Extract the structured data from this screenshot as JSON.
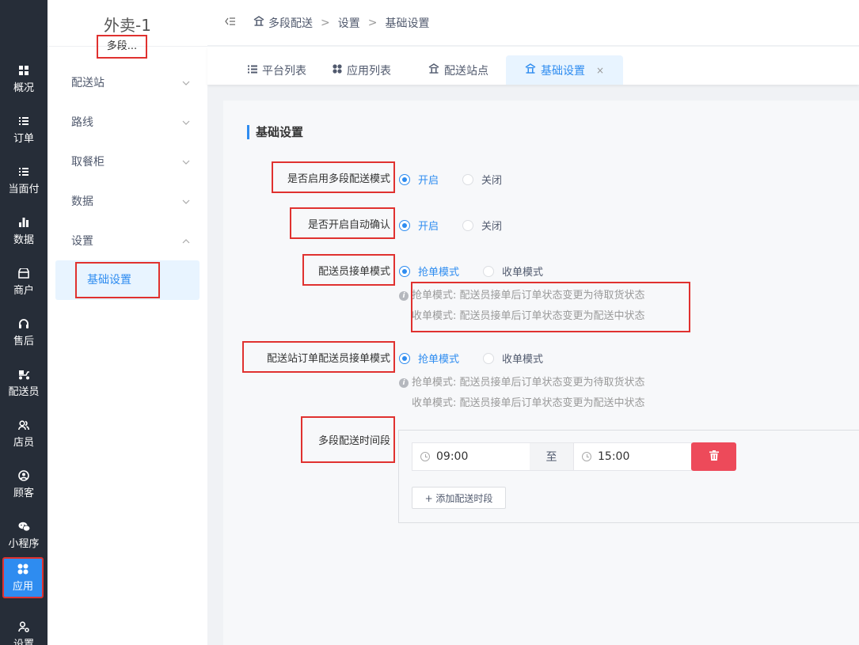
{
  "rail": {
    "items": [
      {
        "label": "概况",
        "icon": "grid-icon"
      },
      {
        "label": "订单",
        "icon": "list-icon"
      },
      {
        "label": "当面付",
        "icon": "list-icon"
      },
      {
        "label": "数据",
        "icon": "bar-chart-icon"
      },
      {
        "label": "商户",
        "icon": "store-icon"
      },
      {
        "label": "售后",
        "icon": "headset-icon"
      },
      {
        "label": "配送员",
        "icon": "scooter-icon"
      },
      {
        "label": "店员",
        "icon": "users-icon"
      },
      {
        "label": "顾客",
        "icon": "user-circle-icon"
      },
      {
        "label": "小程序",
        "icon": "wechat-icon"
      },
      {
        "label": "应用",
        "icon": "apps-icon",
        "active": true
      },
      {
        "label": "设置",
        "icon": "user-gear-icon"
      }
    ]
  },
  "submenu": {
    "title": "外卖-1",
    "subtitle": "多段...",
    "items": [
      {
        "label": "配送站",
        "expanded": false
      },
      {
        "label": "路线",
        "expanded": false
      },
      {
        "label": "取餐柜",
        "expanded": false
      },
      {
        "label": "数据",
        "expanded": false
      },
      {
        "label": "设置",
        "expanded": true
      }
    ],
    "active_child": "基础设置"
  },
  "header": {
    "breadcrumb": [
      "多段配送",
      "设置",
      "基础设置"
    ]
  },
  "tabs": [
    {
      "label": "平台列表",
      "icon": "list-icon"
    },
    {
      "label": "应用列表",
      "icon": "apps-icon"
    },
    {
      "label": "配送站点",
      "icon": "home-icon"
    },
    {
      "label": "基础设置",
      "icon": "home-icon",
      "active": true,
      "closable": true
    }
  ],
  "form": {
    "section_title": "基础设置",
    "multi_mode": {
      "label": "是否启用多段配送模式",
      "options": [
        "开启",
        "关闭"
      ],
      "selected": "开启"
    },
    "auto_confirm": {
      "label": "是否开启自动确认",
      "options": [
        "开启",
        "关闭"
      ],
      "selected": "开启"
    },
    "courier_mode": {
      "label": "配送员接单模式",
      "options": [
        "抢单模式",
        "收单模式"
      ],
      "selected": "抢单模式",
      "hints": [
        "抢单模式: 配送员接单后订单状态变更为待取货状态",
        "收单模式: 配送员接单后订单状态变更为配送中状态"
      ]
    },
    "station_mode": {
      "label": "配送站订单配送员接单模式",
      "options": [
        "抢单模式",
        "收单模式"
      ],
      "selected": "抢单模式",
      "hints": [
        "抢单模式: 配送员接单后订单状态变更为待取货状态",
        "收单模式: 配送员接单后订单状态变更为配送中状态"
      ]
    },
    "time_slots": {
      "label": "多段配送时间段",
      "start": "09:00",
      "separator": "至",
      "end": "15:00",
      "add_label": "+ 添加配送时段"
    }
  },
  "colors": {
    "primary": "#2e8cf0",
    "rail_bg": "#262d38",
    "danger": "#ed4a5a",
    "highlight": "#e0312f"
  }
}
